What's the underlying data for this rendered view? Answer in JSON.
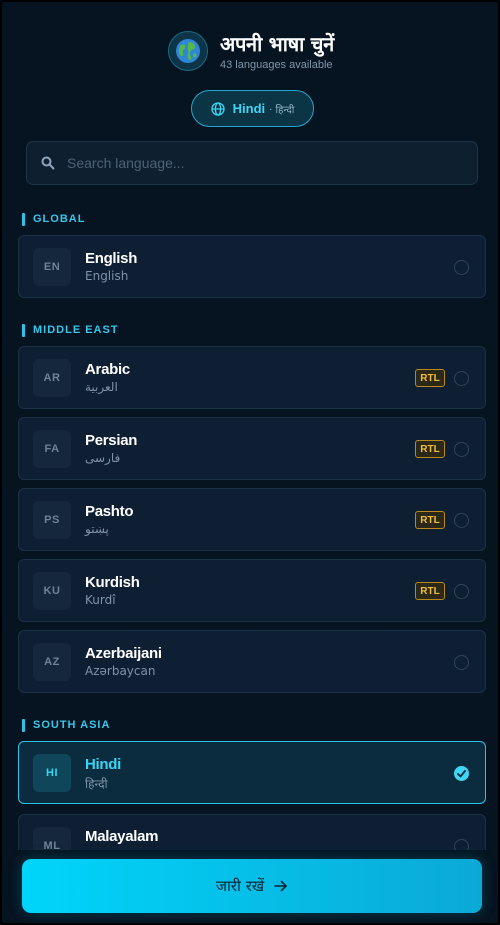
{
  "header": {
    "title": "अपनी भाषा चुनें",
    "subtitle": "43 languages available",
    "globe_icon": "globe-emoji-icon"
  },
  "current": {
    "name": "Hindi",
    "native": "· हिन्दी",
    "icon": "globe-icon"
  },
  "search": {
    "placeholder": "Search language...",
    "value": ""
  },
  "sections": [
    {
      "label": "GLOBAL",
      "languages": [
        {
          "code": "EN",
          "name": "English",
          "native": "English",
          "rtl": false,
          "selected": false
        }
      ]
    },
    {
      "label": "MIDDLE EAST",
      "languages": [
        {
          "code": "AR",
          "name": "Arabic",
          "native": "العربية",
          "rtl": true,
          "selected": false
        },
        {
          "code": "FA",
          "name": "Persian",
          "native": "فارسی",
          "rtl": true,
          "selected": false
        },
        {
          "code": "PS",
          "name": "Pashto",
          "native": "پښتو",
          "rtl": true,
          "selected": false
        },
        {
          "code": "KU",
          "name": "Kurdish",
          "native": "Kurdî",
          "rtl": true,
          "selected": false
        },
        {
          "code": "AZ",
          "name": "Azerbaijani",
          "native": "Azərbaycan",
          "rtl": false,
          "selected": false
        }
      ]
    },
    {
      "label": "SOUTH ASIA",
      "languages": [
        {
          "code": "HI",
          "name": "Hindi",
          "native": "हिन्दी",
          "rtl": false,
          "selected": true
        },
        {
          "code": "ML",
          "name": "Malayalam",
          "native": "",
          "rtl": false,
          "selected": false
        }
      ]
    }
  ],
  "rtl_label": "RTL",
  "continue_label": "जारी रखें",
  "colors": {
    "accent": "#3fd7f5",
    "background": "#061320",
    "card": "#0e1f33",
    "rtl_badge": "#f0bf3a"
  }
}
